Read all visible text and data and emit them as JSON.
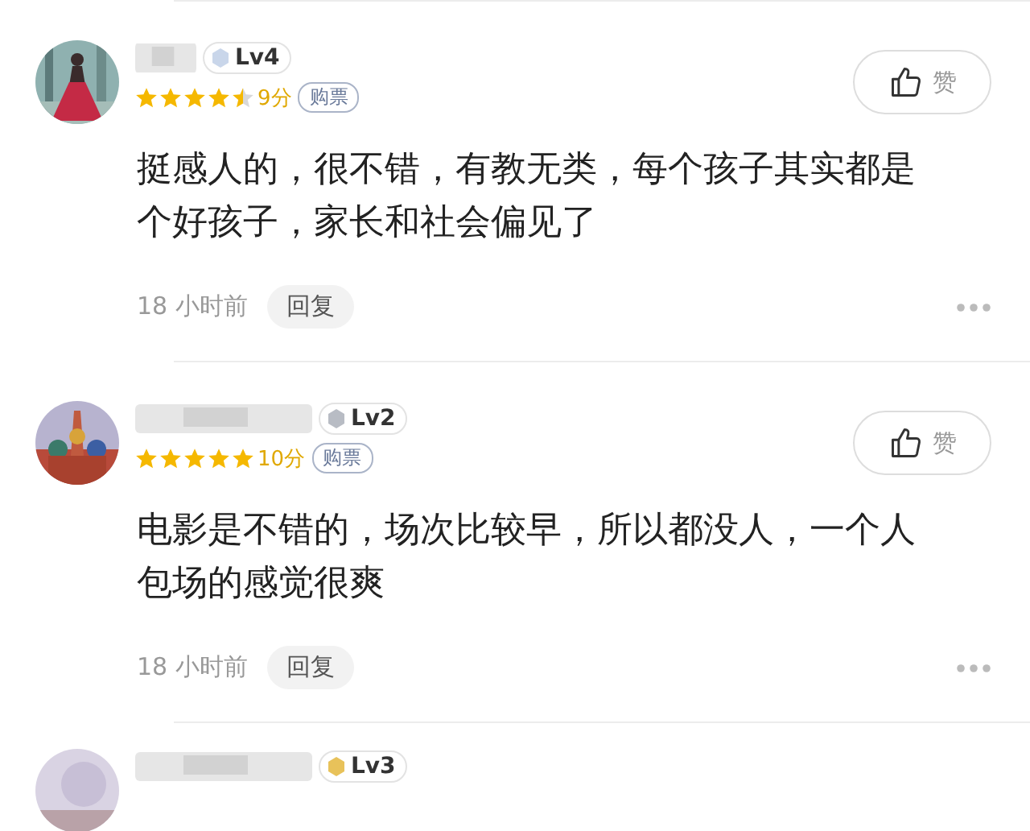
{
  "comments": [
    {
      "level_badge": "Lv4",
      "color": "#c9d6ea",
      "stars": 4.5,
      "score": "9分",
      "tag": "购票",
      "like_label": "赞",
      "text": "挺感人的，很不错，有教无类，每个孩子其实都是个好孩子，家长和社会偏见了",
      "time": "18 小时前",
      "reply": "回复"
    },
    {
      "level_badge": "Lv2",
      "color": "#b8bcc4",
      "stars": 5,
      "score": "10分",
      "tag": "购票",
      "like_label": "赞",
      "text": "电影是不错的，场次比较早，所以都没人，一个人包场的感觉很爽",
      "time": "18 小时前",
      "reply": "回复"
    },
    {
      "level_badge": "Lv3",
      "color": "#e8c25a"
    }
  ]
}
